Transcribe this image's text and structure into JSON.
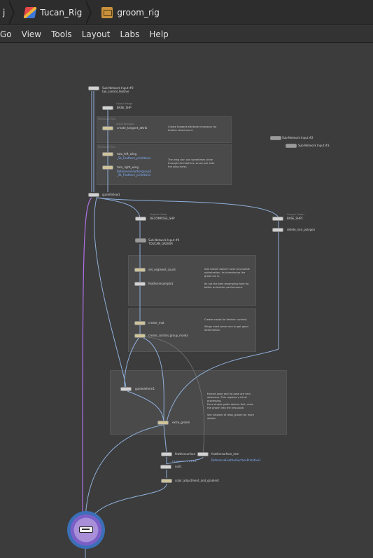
{
  "breadcrumb": {
    "items": [
      {
        "label": "j",
        "icon": "none"
      },
      {
        "label": "Tucan_Rig",
        "icon": "rig-icon"
      },
      {
        "label": "groom_rig",
        "icon": "subnet-icon"
      }
    ]
  },
  "menubar": {
    "items": [
      "Go",
      "View",
      "Tools",
      "Layout",
      "Labs",
      "Help"
    ]
  },
  "network": {
    "nodes": {
      "subnet_input_0": {
        "label": "Sub-Network Input #0",
        "sub": "tail_control_feather"
      },
      "base_shp": {
        "label": "BASE_SHP",
        "type": "Object Merge"
      },
      "create_tangent": {
        "label": "create_tangent_attrib",
        "type": "Attrib Wrangle"
      },
      "tuto_left_wing": {
        "label": "tuto_left_wing",
        "sub": "_Sk_Feathers_primitives"
      },
      "tuto_right_wing": {
        "label": "tuto_right_wing",
        "sub": "ReferenceFeathergroup1",
        "sub2": "_Sk_Feathers_primitives"
      },
      "guidefollow1": {
        "label": "guidefollow1"
      },
      "subnet_input_2": {
        "label": "Sub-Network Input #2"
      },
      "subnet_input_3": {
        "label": "Sub-Network Input #3"
      },
      "deformed_base": {
        "label": "DECOMPOSE_SHP",
        "type": "Unpack Folder"
      },
      "subnet_input_4": {
        "label": "Sub-Network Input #4",
        "sub": "TOUCAN_GROOM"
      },
      "base_shp1": {
        "label": "BASE_SHP1",
        "type": "Unpack Folder"
      },
      "delete_non_polygon": {
        "label": "delete_non_polygon"
      },
      "set_segment_count": {
        "label": "set_segment_count"
      },
      "featherresample1": {
        "label": "featherresample1"
      },
      "create_mat": {
        "label": "create_mat"
      },
      "create_control_group": {
        "label": "create_control_group_masks"
      },
      "guidedeform1": {
        "label": "guidedeform1"
      },
      "extra_groom": {
        "label": "extra_groom"
      },
      "feathersurface": {
        "label": "feathersurface"
      },
      "feathersurface_rest": {
        "label": "feathersurface_rest",
        "sub": "ReferenceFeatherSurfacePrimitive1"
      },
      "null1": {
        "label": "null1"
      },
      "color_adjustment": {
        "label": "color_adjustment_and_gradient"
      }
    },
    "notes": {
      "tangent": "Create tangent attribute necessary for feather attachment.",
      "wing": "The wing skin can sometimes shine through the feathers, so we just hide the wing mesh.",
      "groom": "Add Groom doesn't have any barbie optimization, its intended as the groom as is.",
      "groom2": "Its not the best resampling here for better animation performance.",
      "masks": "Create masks for feather controls.",
      "masks2": "Wings need some care to get good deformation.",
      "deform": "Extract pose and rig pose are very defensive. This requires a bit of processing.",
      "deform2": "Do a simple guide deform first, relax the groom into the new pose.",
      "deform3": "See network of relax_groom for more details."
    }
  },
  "colors": {
    "wire": "#8fb0dc",
    "wire_active": "#b070e8",
    "output_ring": "#3b6fb8"
  }
}
